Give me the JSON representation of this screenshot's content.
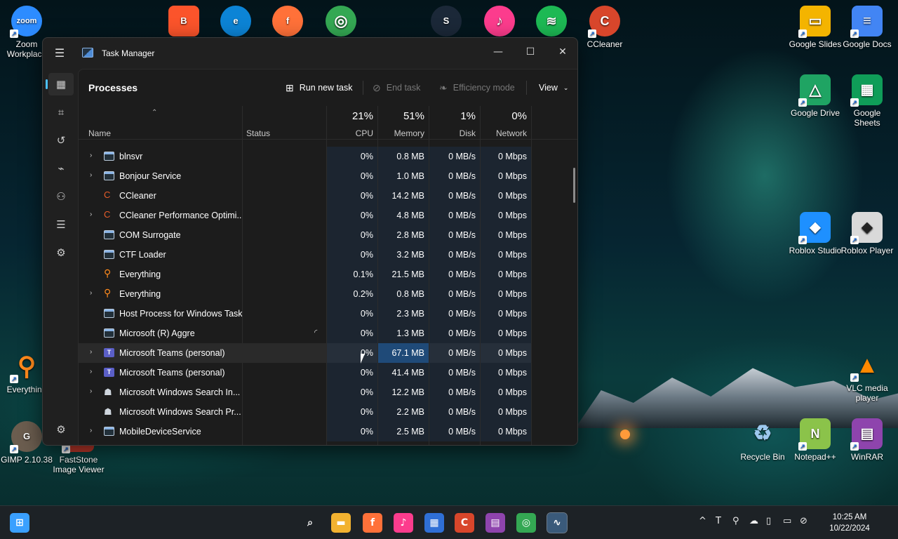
{
  "desktop": {
    "icons_left": [
      {
        "label": "Zoom Workplace",
        "glyph": "zoom",
        "color": "#2d8cff"
      },
      {
        "label": "Everything",
        "glyph": "everything-icon",
        "color": "#ff8a1c"
      },
      {
        "label": "GIMP 2.10.38",
        "glyph": "gimp-icon",
        "color": "#6b5d4f"
      },
      {
        "label": "FastStone Image Viewer",
        "glyph": "faststone-icon",
        "color": "#c0392b"
      }
    ],
    "icons_top": [
      {
        "label": "Brave",
        "color": "#fb542b",
        "glyph": "B"
      },
      {
        "label": "Edge",
        "color": "#0c84d6",
        "glyph": "e"
      },
      {
        "label": "Firefox",
        "color": "#ff7139",
        "glyph": "f"
      },
      {
        "label": "Chrome",
        "color": "#34a853",
        "glyph": "◎"
      },
      {
        "label": "Steam",
        "color": "#1b2838",
        "glyph": "S"
      },
      {
        "label": "iTunes",
        "color": "#fc3c8d",
        "glyph": "♪"
      },
      {
        "label": "Spotify",
        "color": "#1db954",
        "glyph": "≋"
      }
    ],
    "icons_right": [
      {
        "label": "CCleaner",
        "color": "#d8462b",
        "glyph": "C"
      },
      {
        "label": "Google Slides",
        "color": "#f4b400",
        "glyph": "▭"
      },
      {
        "label": "Google Docs",
        "color": "#4285f4",
        "glyph": "≡"
      },
      {
        "label": "Google Drive",
        "color": "#1fa463",
        "glyph": "△"
      },
      {
        "label": "Google Sheets",
        "color": "#0f9d58",
        "glyph": "▦"
      },
      {
        "label": "Roblox Studio",
        "color": "#1e90ff",
        "glyph": "◆"
      },
      {
        "label": "Roblox Player",
        "color": "#d9d9d9",
        "glyph": "◈"
      },
      {
        "label": "VLC media player",
        "color": "#ff8800",
        "glyph": "▲"
      },
      {
        "label": "Recycle Bin",
        "color": "#6fa8dc",
        "glyph": "♻"
      },
      {
        "label": "Notepad++",
        "color": "#8bc34a",
        "glyph": "N"
      },
      {
        "label": "WinRAR",
        "color": "#8e44ad",
        "glyph": "▤"
      }
    ]
  },
  "window": {
    "title": "Task Manager",
    "minimize": "—",
    "maximize": "☐",
    "close": "✕"
  },
  "toolbar": {
    "page_title": "Processes",
    "run_new_task": "Run new task",
    "end_task": "End task",
    "efficiency_mode": "Efficiency mode",
    "view": "View"
  },
  "columns": {
    "name": "Name",
    "status": "Status",
    "cpu_pct": "21%",
    "cpu": "CPU",
    "memory_pct": "51%",
    "memory": "Memory",
    "disk_pct": "1%",
    "disk": "Disk",
    "network_pct": "0%",
    "network": "Network"
  },
  "processes": [
    {
      "name": "blnsvr",
      "expand": true,
      "icon": "window",
      "cpu": "0%",
      "memory": "0.8 MB",
      "disk": "0 MB/s",
      "network": "0 Mbps"
    },
    {
      "name": "Bonjour Service",
      "expand": true,
      "icon": "window",
      "cpu": "0%",
      "memory": "1.0 MB",
      "disk": "0 MB/s",
      "network": "0 Mbps"
    },
    {
      "name": "CCleaner",
      "expand": false,
      "icon": "ccleaner",
      "cpu": "0%",
      "memory": "14.2 MB",
      "disk": "0 MB/s",
      "network": "0 Mbps"
    },
    {
      "name": "CCleaner Performance Optimi...",
      "expand": true,
      "icon": "ccleaner",
      "cpu": "0%",
      "memory": "4.8 MB",
      "disk": "0 MB/s",
      "network": "0 Mbps"
    },
    {
      "name": "COM Surrogate",
      "expand": false,
      "icon": "window",
      "cpu": "0%",
      "memory": "2.8 MB",
      "disk": "0 MB/s",
      "network": "0 Mbps"
    },
    {
      "name": "CTF Loader",
      "expand": false,
      "icon": "window",
      "cpu": "0%",
      "memory": "3.2 MB",
      "disk": "0 MB/s",
      "network": "0 Mbps"
    },
    {
      "name": "Everything",
      "expand": false,
      "icon": "everything",
      "cpu": "0.1%",
      "memory": "21.5 MB",
      "disk": "0 MB/s",
      "network": "0 Mbps"
    },
    {
      "name": "Everything",
      "expand": true,
      "icon": "everything",
      "cpu": "0.2%",
      "memory": "0.8 MB",
      "disk": "0 MB/s",
      "network": "0 Mbps"
    },
    {
      "name": "Host Process for Windows Tasks",
      "expand": false,
      "icon": "window",
      "cpu": "0%",
      "memory": "2.3 MB",
      "disk": "0 MB/s",
      "network": "0 Mbps"
    },
    {
      "name": "Microsoft (R) Aggre",
      "expand": false,
      "icon": "window",
      "cpu": "0%",
      "memory": "1.3 MB",
      "disk": "0 MB/s",
      "network": "0 Mbps",
      "spinner": true
    },
    {
      "name": "Microsoft Teams (personal)",
      "expand": true,
      "icon": "teams",
      "cpu": "0%",
      "memory": "67.1 MB",
      "disk": "0 MB/s",
      "network": "0 Mbps",
      "hover": true
    },
    {
      "name": "Microsoft Teams (personal)",
      "expand": true,
      "icon": "teams",
      "cpu": "0%",
      "memory": "41.4 MB",
      "disk": "0 MB/s",
      "network": "0 Mbps"
    },
    {
      "name": "Microsoft Windows Search In...",
      "expand": true,
      "icon": "search",
      "cpu": "0%",
      "memory": "12.2 MB",
      "disk": "0 MB/s",
      "network": "0 Mbps"
    },
    {
      "name": "Microsoft Windows Search Pr...",
      "expand": false,
      "icon": "search",
      "cpu": "0%",
      "memory": "2.2 MB",
      "disk": "0 MB/s",
      "network": "0 Mbps"
    },
    {
      "name": "MobileDeviceService",
      "expand": true,
      "icon": "window",
      "cpu": "0%",
      "memory": "2.5 MB",
      "disk": "0 MB/s",
      "network": "0 Mbps"
    }
  ],
  "taskbar": {
    "apps": [
      {
        "name": "start",
        "color": "#3aa0ff",
        "glyph": "⊞"
      },
      {
        "name": "search",
        "color": "transparent",
        "glyph": "⌕"
      },
      {
        "name": "file-explorer",
        "color": "#f2b230",
        "glyph": "▬"
      },
      {
        "name": "firefox",
        "color": "#ff7139",
        "glyph": "f"
      },
      {
        "name": "itunes",
        "color": "#fc3c8d",
        "glyph": "♪"
      },
      {
        "name": "microsoft-store",
        "color": "#2f6fd6",
        "glyph": "▦"
      },
      {
        "name": "ccleaner",
        "color": "#d8462b",
        "glyph": "C"
      },
      {
        "name": "winrar",
        "color": "#8e44ad",
        "glyph": "▤"
      },
      {
        "name": "chrome",
        "color": "#34a853",
        "glyph": "◎"
      },
      {
        "name": "task-manager",
        "color": "#3a5a7a",
        "glyph": "∿"
      }
    ],
    "tray": [
      "^",
      "T",
      "⚲",
      "☁",
      "▯",
      "▭",
      "⊘"
    ],
    "time": "10:25 AM",
    "date": "10/22/2024"
  }
}
